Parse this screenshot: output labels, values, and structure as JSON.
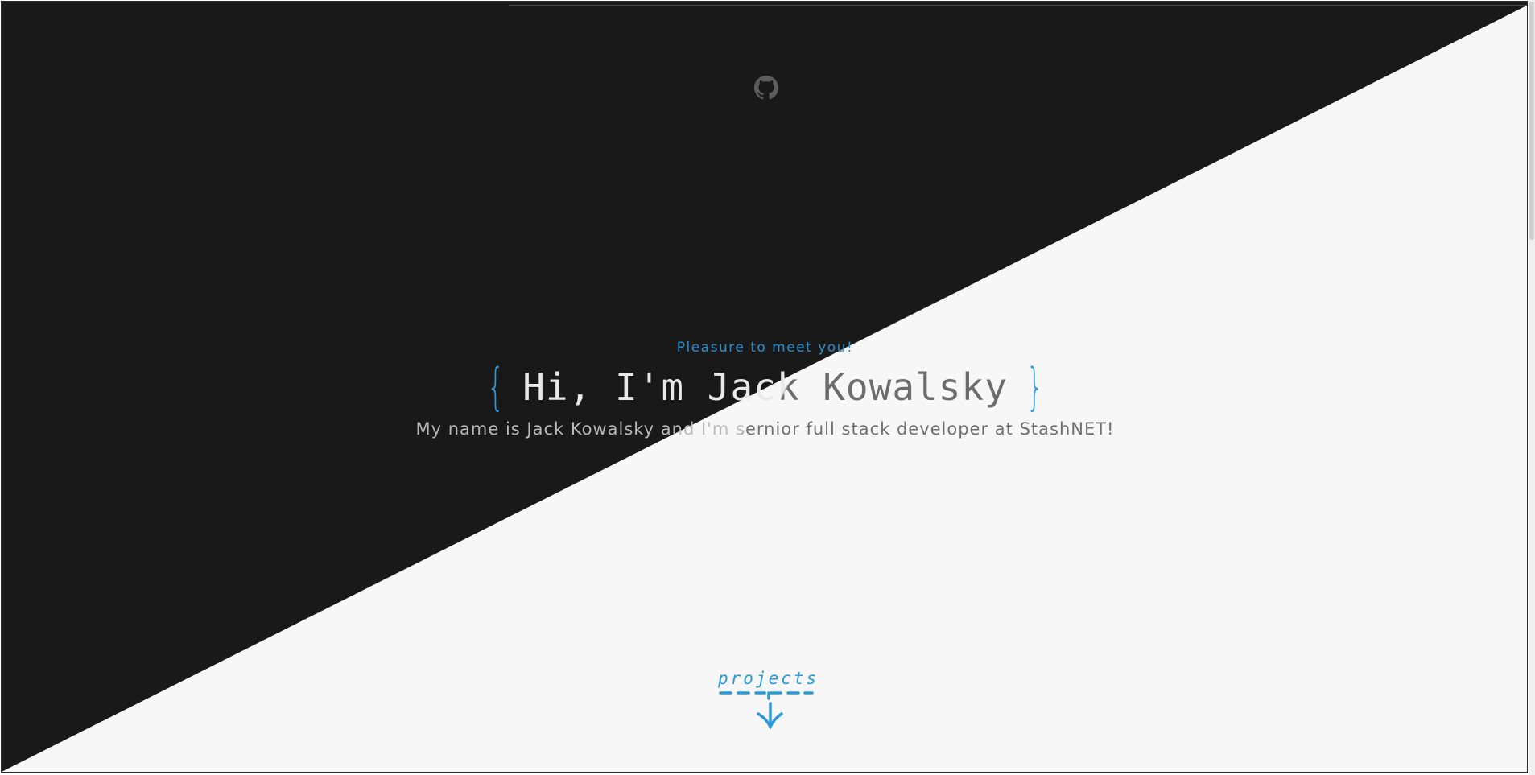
{
  "hero": {
    "greeting": "Pleasure to meet you!",
    "brace_open": "{",
    "title": "Hi, I'm Jack Kowalsky",
    "brace_close": "}",
    "subtitle": "My name is Jack Kowalsky and I'm sernior full stack developer at StashNET!"
  },
  "nav": {
    "github_icon": "github-icon"
  },
  "scroll_link": {
    "label": "projects",
    "icon": "arrow-down-icon"
  },
  "colors": {
    "dark_bg": "#191919",
    "light_bg": "#f7f7f7",
    "accent": "#2a9ad8"
  }
}
